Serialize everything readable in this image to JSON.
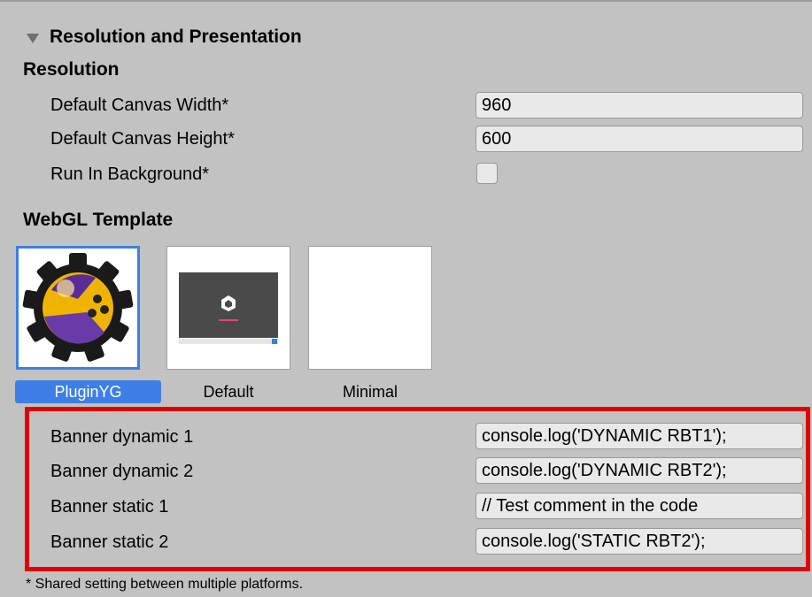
{
  "section": {
    "title": "Resolution and Presentation",
    "toggle_icon": "triangle-down-icon"
  },
  "resolution": {
    "header": "Resolution",
    "canvas_width_label": "Default Canvas Width*",
    "canvas_width_value": "960",
    "canvas_height_label": "Default Canvas Height*",
    "canvas_height_value": "600",
    "run_in_background_label": "Run In Background*",
    "run_in_background_checked": false
  },
  "webgl_template": {
    "header": "WebGL Template",
    "templates": [
      {
        "label": "PluginYG",
        "selected": true
      },
      {
        "label": "Default",
        "selected": false
      },
      {
        "label": "Minimal",
        "selected": false
      }
    ]
  },
  "banners": [
    {
      "label": "Banner dynamic 1",
      "value": "console.log('DYNAMIC RBT1');"
    },
    {
      "label": "Banner dynamic 2",
      "value": "console.log('DYNAMIC RBT2');"
    },
    {
      "label": "Banner static 1",
      "value": "// Test comment in the code"
    },
    {
      "label": "Banner static 2",
      "value": "console.log('STATIC RBT2');"
    }
  ],
  "footnote": "* Shared setting between multiple platforms.",
  "colors": {
    "panel_bg": "#c2c2c2",
    "field_bg": "#e9e9e9",
    "selection_blue": "#3d7fe6",
    "highlight_red": "#e00000"
  }
}
